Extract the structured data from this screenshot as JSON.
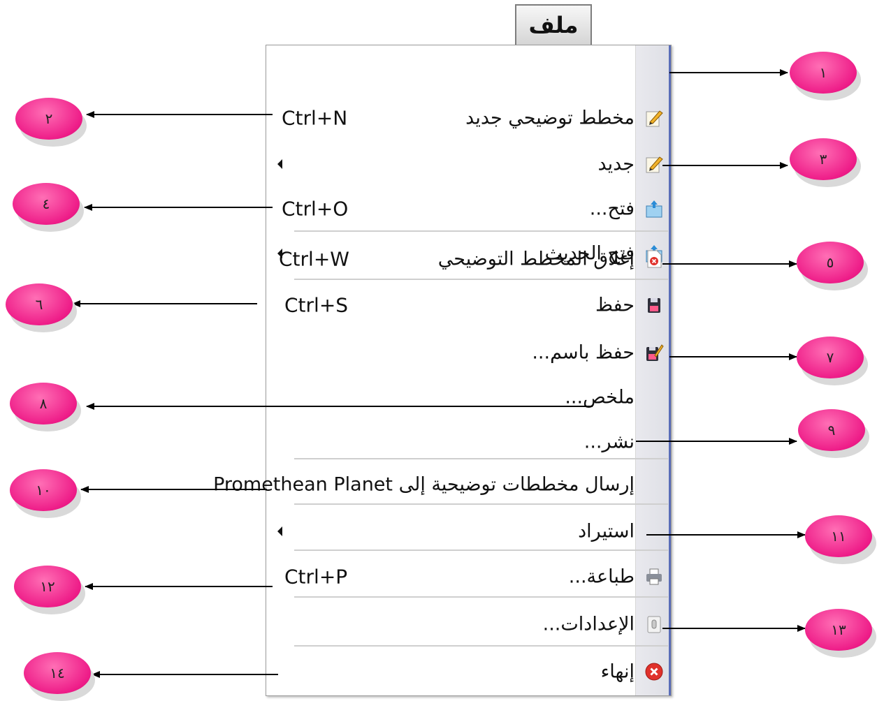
{
  "tab": {
    "label": "ملف"
  },
  "menu": {
    "items": [
      {
        "label": "مخطط توضيحي جديد",
        "shortcut": "Ctrl+N",
        "icon": "new-flipchart-icon"
      },
      {
        "label": "جديد",
        "shortcut": "",
        "icon": "new-icon",
        "submenu": true
      },
      {
        "label": "فتح...",
        "shortcut": "Ctrl+O",
        "icon": "open-icon"
      },
      {
        "label": "فتح الحديث",
        "shortcut": "",
        "icon": "open-recent-icon",
        "submenu": true
      },
      {
        "label": "إغلاق المخطط التوضيحي",
        "shortcut": "Ctrl+W",
        "icon": "close-document-icon"
      },
      {
        "label": "حفظ",
        "shortcut": "Ctrl+S",
        "icon": "save-icon"
      },
      {
        "label": "حفظ باسم...",
        "shortcut": "",
        "icon": "save-as-icon"
      },
      {
        "label": "ملخص...",
        "shortcut": "",
        "icon": ""
      },
      {
        "label": "نشر...",
        "shortcut": "",
        "icon": ""
      },
      {
        "label": "إرسال مخططات توضيحية إلى Promethean Planet",
        "shortcut": "",
        "icon": ""
      },
      {
        "label": "استيراد",
        "shortcut": "",
        "icon": "",
        "submenu": true
      },
      {
        "label": "طباعة...",
        "shortcut": "Ctrl+P",
        "icon": "print-icon"
      },
      {
        "label": "الإعدادات...",
        "shortcut": "",
        "icon": "settings-icon"
      },
      {
        "label": "إنهاء",
        "shortcut": "",
        "icon": "exit-icon"
      }
    ]
  },
  "callouts": [
    "١",
    "٢",
    "٣",
    "٤",
    "٥",
    "٦",
    "٧",
    "٨",
    "٩",
    "١٠",
    "١١",
    "١٢",
    "١٣",
    "١٤"
  ],
  "colors": {
    "callout_fill": "#ee1c88",
    "menu_strip_border": "#5a6db8",
    "exit_icon": "#e0312b"
  }
}
